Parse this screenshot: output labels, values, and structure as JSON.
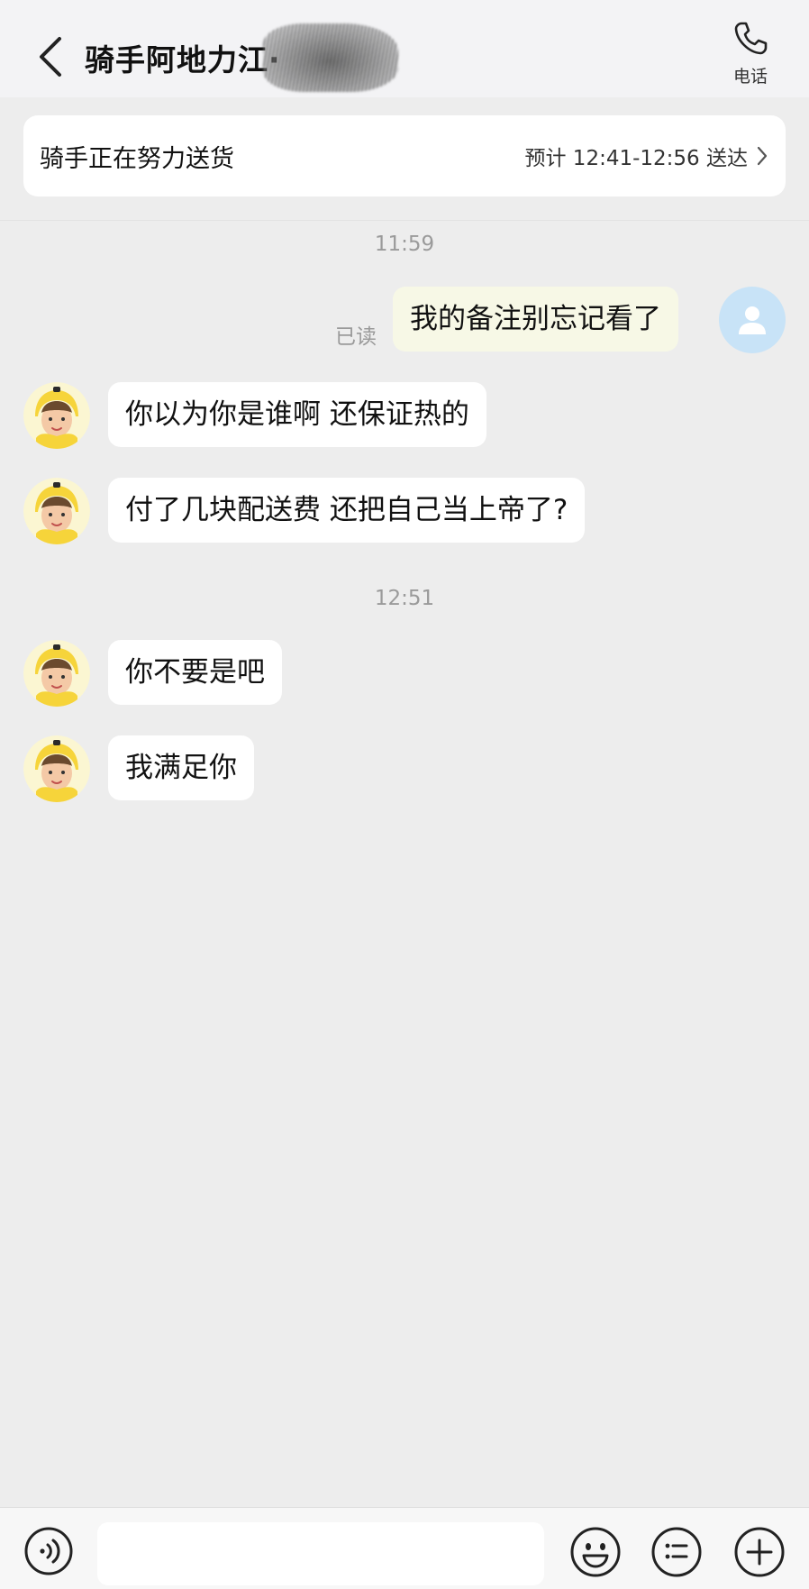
{
  "header": {
    "title": "骑手阿地力江·",
    "call_label": "电话",
    "back_icon": "chevron-left-icon",
    "call_icon": "phone-icon"
  },
  "status": {
    "text": "骑手正在努力送货",
    "eta": "预计 12:41-12:56 送达",
    "chevron_icon": "chevron-right-icon"
  },
  "chat": {
    "timestamps": [
      "11:59",
      "12:51"
    ],
    "read_label": "已读",
    "messages": [
      {
        "from": "me",
        "text": "我的备注别忘记看了"
      },
      {
        "from": "rider",
        "text": "你以为你是谁啊 还保证热的"
      },
      {
        "from": "rider",
        "text": "付了几块配送费 还把自己当上帝了?"
      },
      {
        "from": "rider",
        "text": "你不要是吧"
      },
      {
        "from": "rider",
        "text": "我满足你"
      }
    ]
  },
  "input_bar": {
    "placeholder": "",
    "icons": [
      "voice-icon",
      "emoji-icon",
      "quick-reply-icon",
      "plus-icon"
    ]
  },
  "colors": {
    "background": "#ededed",
    "my_bubble": "#f7f8e6",
    "rider_bubble": "#ffffff",
    "user_avatar": "#c8e3f7",
    "rider_helmet": "#f6d43a"
  }
}
